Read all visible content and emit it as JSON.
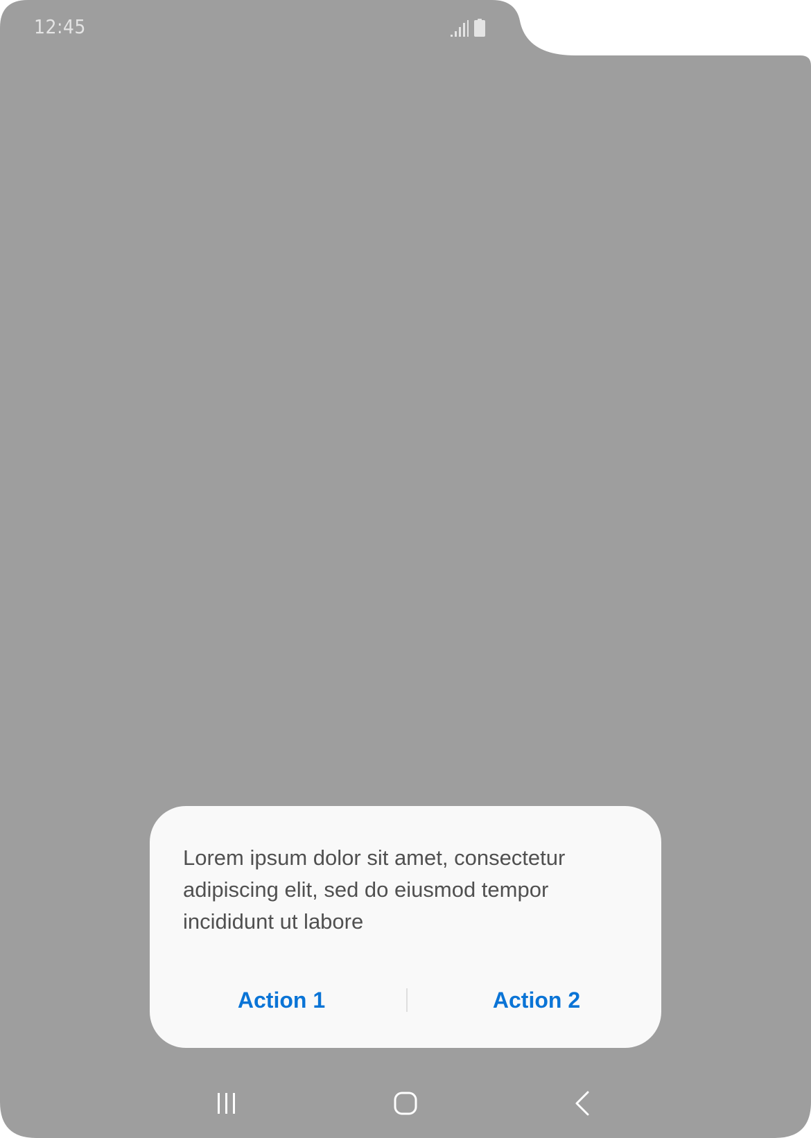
{
  "status_bar": {
    "time": "12:45",
    "icons": [
      "signal-icon",
      "battery-icon"
    ]
  },
  "dialog": {
    "message": "Lorem ipsum dolor sit amet, consectetur adipiscing elit, sed do eiusmod tempor incididunt ut labore",
    "actions": [
      {
        "label": "Action 1"
      },
      {
        "label": "Action 2"
      }
    ]
  },
  "navigation_bar": {
    "buttons": [
      "recent-apps-icon",
      "home-icon",
      "back-icon"
    ]
  },
  "colors": {
    "screen_background": "#9e9e9e",
    "dialog_background": "#f9f9f9",
    "action_text": "#0a74d6",
    "message_text": "#505050",
    "status_text": "#e4e4e4"
  }
}
